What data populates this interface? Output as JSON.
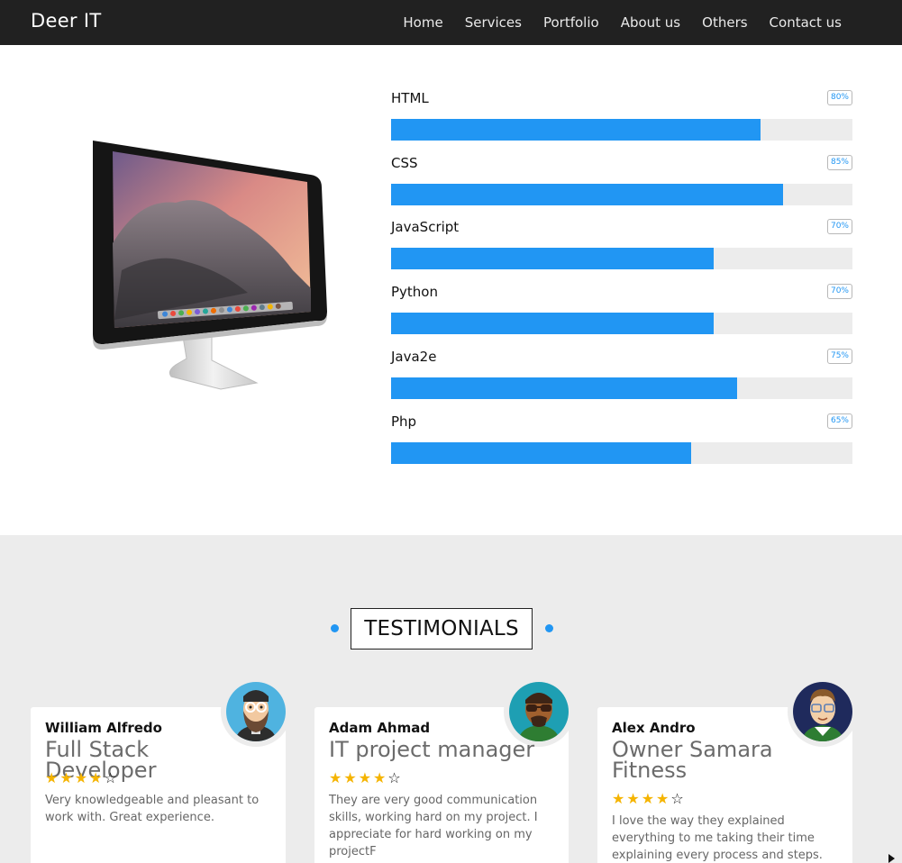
{
  "brand": "Deer IT",
  "nav": [
    "Home",
    "Services",
    "Portfolio",
    "About us",
    "Others",
    "Contact us"
  ],
  "skills": [
    {
      "name": "HTML",
      "percent_label": "80%",
      "value": 80
    },
    {
      "name": "CSS",
      "percent_label": "85%",
      "value": 85
    },
    {
      "name": "JavaScript",
      "percent_label": "70%",
      "value": 70
    },
    {
      "name": "Python",
      "percent_label": "70%",
      "value": 70
    },
    {
      "name": "Java2e",
      "percent_label": "75%",
      "value": 75
    },
    {
      "name": "Php",
      "percent_label": "65%",
      "value": 65
    }
  ],
  "testimonials": {
    "title": "TESTIMONIALS",
    "cards": [
      {
        "name": "William Alfredo",
        "role": "Full Stack Developer",
        "rating": 4,
        "max_rating": 5,
        "text": "Very knowledgeable and pleasant to work with. Great experience.",
        "avatar": "bearded-man-glasses-avatar"
      },
      {
        "name": "Adam Ahmad",
        "role": "IT project manager",
        "rating": 4,
        "max_rating": 5,
        "text": "They are very good communication skills, working hard on my project. I appreciate for hard working on my projectF",
        "avatar": "man-sunglasses-avatar"
      },
      {
        "name": "Alex Andro",
        "role": "Owner Samara Fitness",
        "rating": 4,
        "max_rating": 5,
        "text": "I love the way they explained everything to me taking their time explaining every process and steps. I",
        "avatar": "man-glasses-avatar"
      }
    ]
  },
  "colors": {
    "navbar": "#212121",
    "accent": "#2196f3",
    "track": "#ececec",
    "star": "#f5b400",
    "section_bg": "#ececec"
  }
}
